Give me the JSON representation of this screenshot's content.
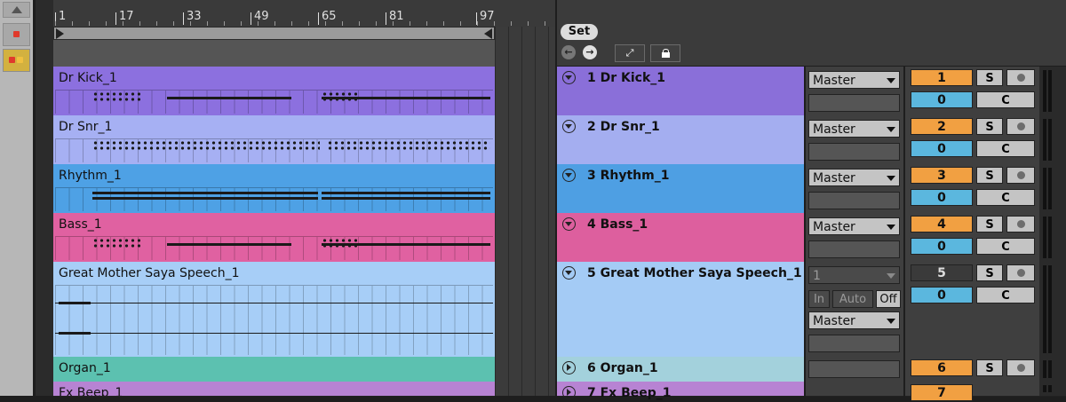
{
  "ruler": {
    "ticks": [
      "1",
      "17",
      "33",
      "49",
      "65",
      "81",
      "97"
    ]
  },
  "header": {
    "set_label": "Set",
    "back_icon": "arrow-left-icon",
    "forward_icon": "arrow-right-icon",
    "expand_icon": "expand-icon",
    "lock_icon": "lock-icon"
  },
  "colors": {
    "accent": "#f1a042",
    "pan": "#5bb7de"
  },
  "tracks": [
    {
      "clip": "Dr Kick_1",
      "name": "1 Dr Kick_1",
      "output": "Master",
      "number": "1",
      "pan": "0",
      "solo": "S",
      "crossfade": "C",
      "color": "#8c70df",
      "color_light": "#8a6fd9"
    },
    {
      "clip": "Dr Snr_1",
      "name": "2 Dr Snr_1",
      "output": "Master",
      "number": "2",
      "pan": "0",
      "solo": "S",
      "crossfade": "C",
      "color": "#a6b0f3",
      "color_light": "#a4aef0"
    },
    {
      "clip": "Rhythm_1",
      "name": "3 Rhythm_1",
      "output": "Master",
      "number": "3",
      "pan": "0",
      "solo": "S",
      "crossfade": "C",
      "color": "#4ea1e5",
      "color_light": "#4e9fe3"
    },
    {
      "clip": "Bass_1",
      "name": "4 Bass_1",
      "output": "Master",
      "number": "4",
      "pan": "0",
      "solo": "S",
      "crossfade": "C",
      "color": "#e061a1",
      "color_light": "#dd5f9e"
    },
    {
      "clip": "Great Mother Saya Speech_1",
      "name": "5 Great Mother Saya Speech_1",
      "input": "1",
      "monitor": [
        "In",
        "Auto",
        "Off"
      ],
      "output": "Master",
      "number": "5",
      "pan": "0",
      "solo": "S",
      "crossfade": "C",
      "color": "#a7cef7",
      "color_light": "#a4cbf5"
    },
    {
      "clip": "Organ_1",
      "name": "6 Organ_1",
      "number": "6",
      "solo": "S",
      "color": "#5cc1b0",
      "color_light": "#a3d1dc"
    },
    {
      "clip": "Fx Beep_1",
      "name": "7 Fx Beep_1",
      "number": "7",
      "color": "#b783d3",
      "color_light": "#b783d3"
    }
  ]
}
